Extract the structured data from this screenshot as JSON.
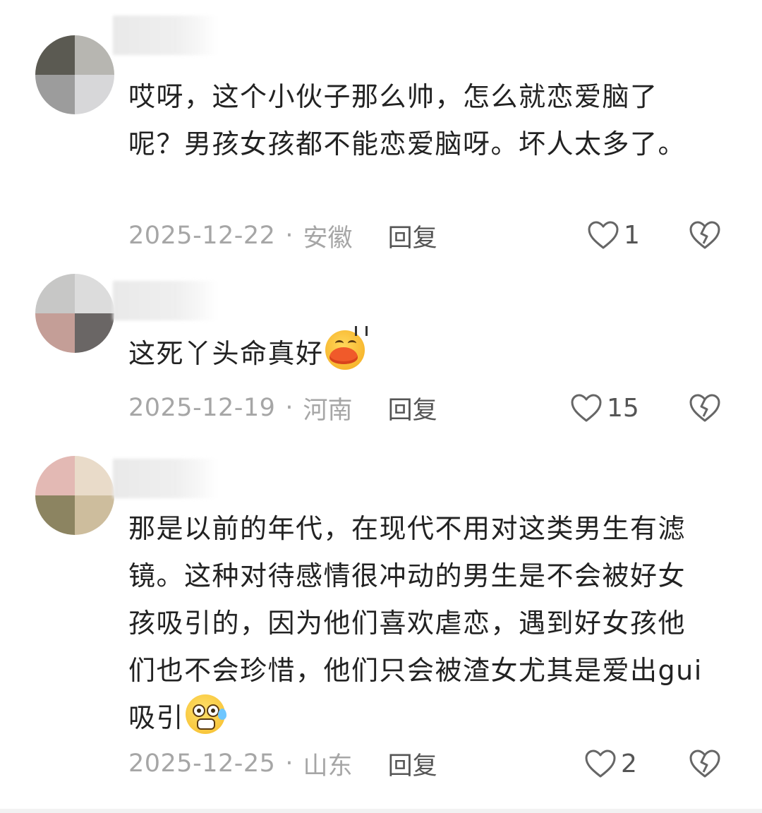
{
  "comments": [
    {
      "text": "哎呀，这个小伙子那么帅，怎么就恋爱脑了呢？男孩女孩都不能恋爱脑呀。坏人太多了。",
      "date": "2025-12-22",
      "separator": "·",
      "location": "安徽",
      "reply_label": "回复",
      "likes": "1",
      "avatar_colors": [
        "#5b5a52",
        "#b7b6b1",
        "#9c9c9c",
        "#d7d7d9"
      ]
    },
    {
      "text": "这死丫头命真好",
      "emoji": "kiss-sweat-emoji",
      "date": "2025-12-19",
      "separator": "·",
      "location": "河南",
      "reply_label": "回复",
      "likes": "15",
      "avatar_colors": [
        "#c7c7c6",
        "#dcdcdc",
        "#c49e97",
        "#6a6665"
      ]
    },
    {
      "text": "那是以前的年代，在现代不用对这类男生有滤镜。这种对待感情很冲动的男生是不会被好女孩吸引的，因为他们喜欢虐恋，遇到好女孩他们也不会珍惜，他们只会被渣女尤其是爱出gui吸引",
      "emoji": "shocked-sweat-emoji",
      "date": "2025-12-25",
      "separator": "·",
      "location": "山东",
      "reply_label": "回复",
      "likes": "2",
      "avatar_colors": [
        "#e3b9b4",
        "#e9dbc9",
        "#8c8461",
        "#cdbd9d"
      ]
    }
  ],
  "colors": {
    "text": "#222222",
    "meta": "#a6a6a6",
    "reply": "#555555",
    "icon": "#666666"
  }
}
